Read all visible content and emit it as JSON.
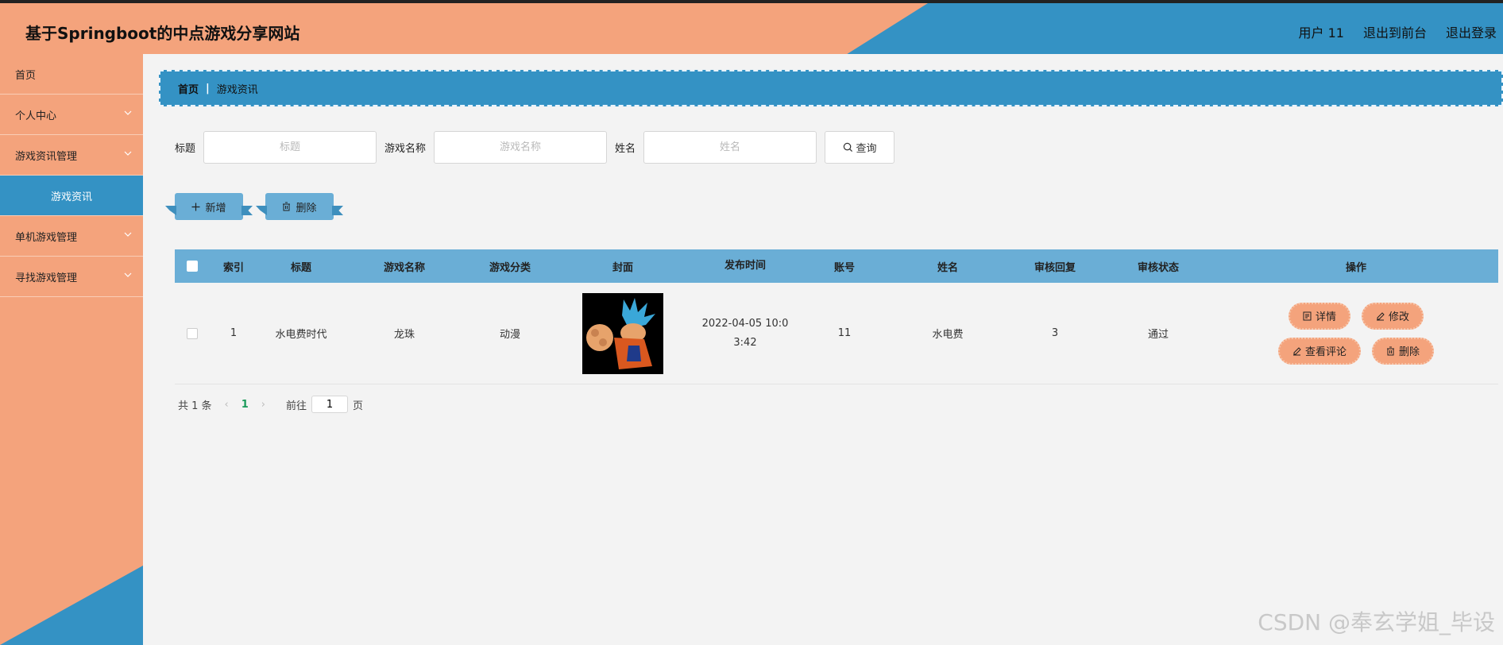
{
  "header": {
    "title": "基于Springboot的中点游戏分享网站",
    "user": "用户 11",
    "back_front": "退出到前台",
    "logout": "退出登录"
  },
  "sidebar": {
    "items": [
      {
        "label": "首页",
        "chevron": false
      },
      {
        "label": "个人中心",
        "chevron": true
      },
      {
        "label": "游戏资讯管理",
        "chevron": true
      },
      {
        "label": "游戏资讯",
        "chevron": false,
        "active": true
      },
      {
        "label": "单机游戏管理",
        "chevron": true
      },
      {
        "label": "寻找游戏管理",
        "chevron": true
      }
    ]
  },
  "breadcrumb": {
    "home": "首页",
    "current": "游戏资讯"
  },
  "search": {
    "title_label": "标题",
    "title_placeholder": "标题",
    "game_label": "游戏名称",
    "game_placeholder": "游戏名称",
    "name_label": "姓名",
    "name_placeholder": "姓名",
    "query_button": "查询"
  },
  "actions": {
    "add": "新增",
    "delete": "删除"
  },
  "table": {
    "headers": [
      "索引",
      "标题",
      "游戏名称",
      "游戏分类",
      "封面",
      "发布时间",
      "账号",
      "姓名",
      "审核回复",
      "审核状态",
      "操作"
    ],
    "rows": [
      {
        "index": "1",
        "title": "水电费时代",
        "game": "龙珠",
        "category": "动漫",
        "time_line1": "2022-04-05 10:0",
        "time_line2": "3:42",
        "account": "11",
        "name": "水电费",
        "reply": "3",
        "status": "通过",
        "ops": {
          "detail": "详情",
          "edit": "修改",
          "comments": "查看评论",
          "delete": "删除"
        }
      }
    ]
  },
  "pager": {
    "total": "共 1 条",
    "current": "1",
    "goto": "前往",
    "page_input": "1",
    "page_suffix": "页"
  },
  "watermark": "CSDN @奉玄学姐_毕设",
  "colors": {
    "orange": "#f4a37c",
    "blue": "#3492c4",
    "table_header": "#6aaed6"
  }
}
